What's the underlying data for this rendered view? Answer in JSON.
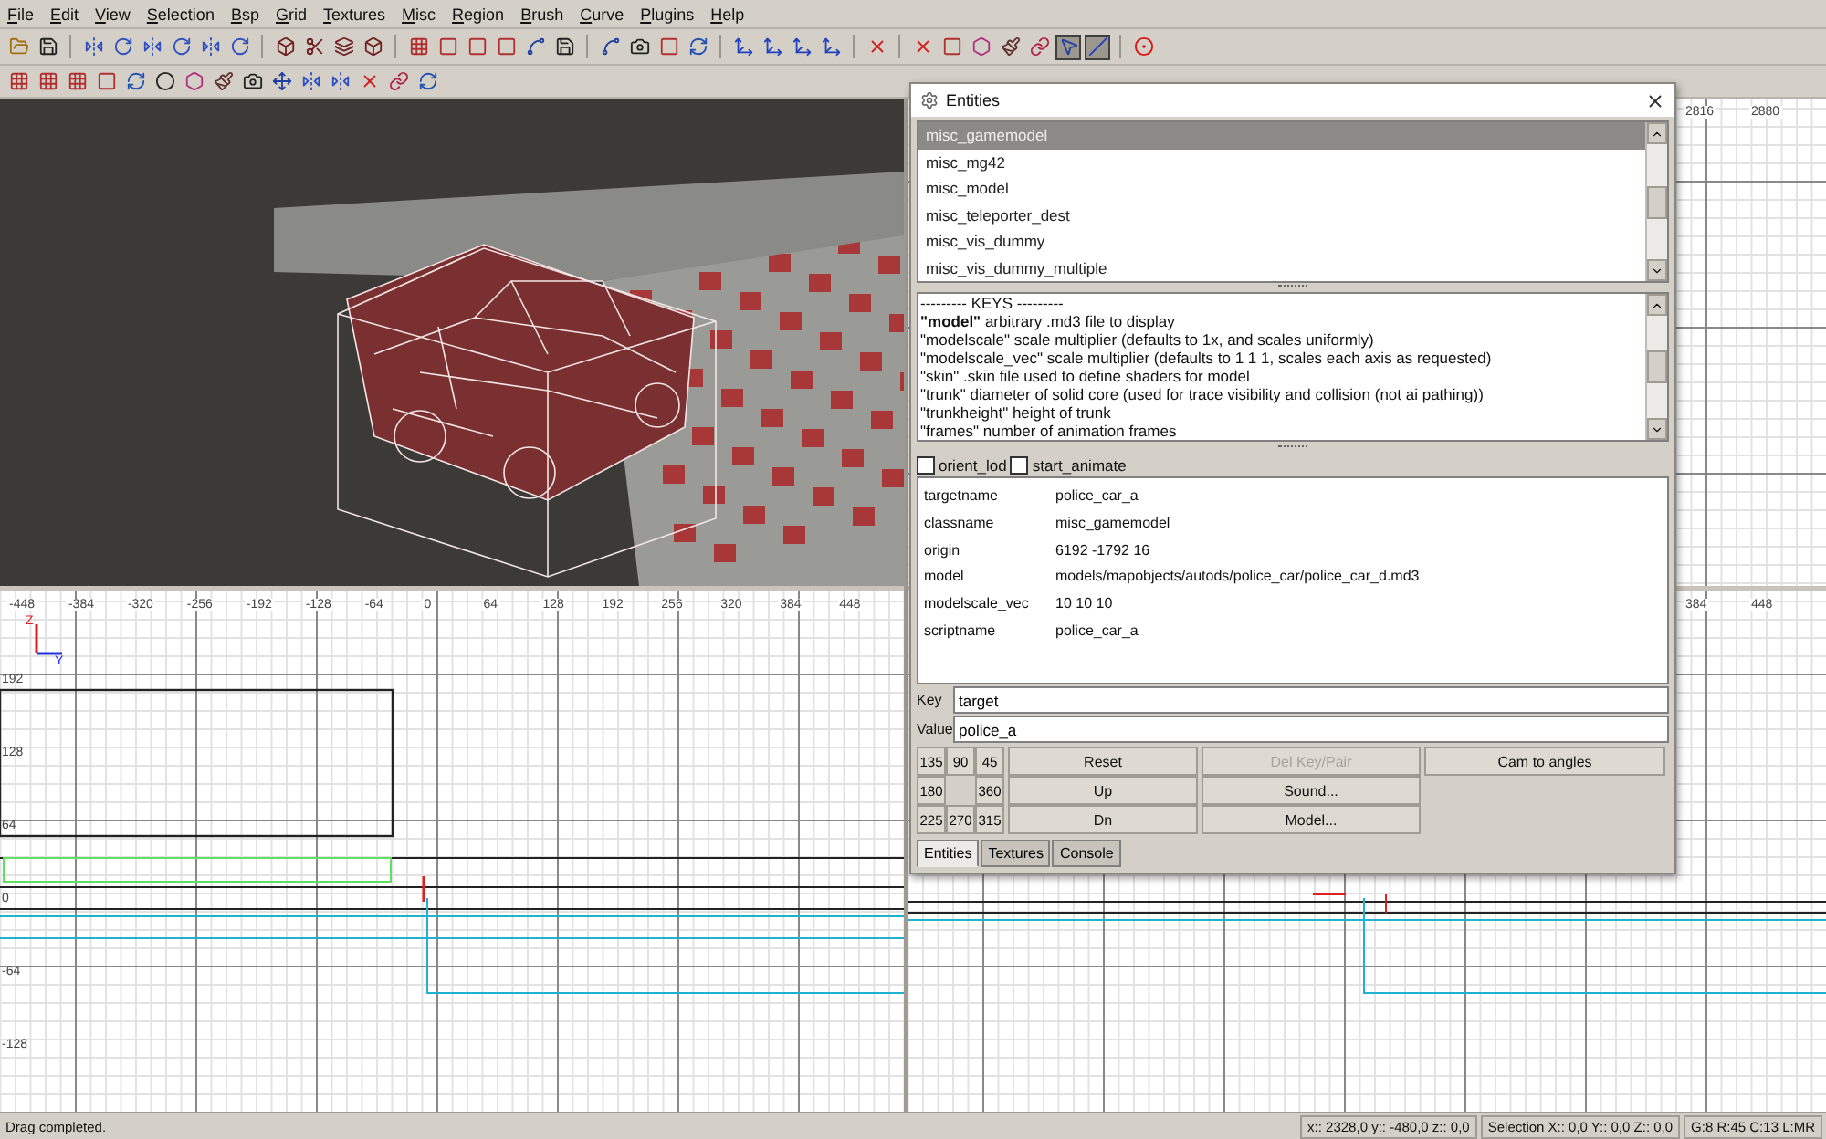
{
  "menu": [
    "File",
    "Edit",
    "View",
    "Selection",
    "Bsp",
    "Grid",
    "Textures",
    "Misc",
    "Region",
    "Brush",
    "Curve",
    "Plugins",
    "Help"
  ],
  "toolbar_1": [
    [
      {
        "kind": "open",
        "pressed": false
      },
      {
        "kind": "save",
        "pressed": false
      }
    ],
    [
      {
        "kind": "flip",
        "pressed": false
      },
      {
        "kind": "rotate",
        "pressed": false
      },
      {
        "kind": "flip",
        "pressed": false
      },
      {
        "kind": "rotate",
        "pressed": false
      },
      {
        "kind": "flip",
        "pressed": false
      },
      {
        "kind": "rotate",
        "pressed": false
      }
    ],
    [
      {
        "kind": "hollow",
        "pressed": false
      },
      {
        "kind": "subtract",
        "pressed": false
      },
      {
        "kind": "merge",
        "pressed": false
      },
      {
        "kind": "hollow",
        "pressed": false
      }
    ],
    [
      {
        "kind": "grid",
        "pressed": false
      },
      {
        "kind": "frame",
        "pressed": false
      },
      {
        "kind": "frame",
        "pressed": false
      },
      {
        "kind": "frame",
        "pressed": false
      },
      {
        "kind": "vertex",
        "pressed": false
      },
      {
        "kind": "save",
        "pressed": false
      }
    ],
    [
      {
        "kind": "vertex",
        "pressed": false
      },
      {
        "kind": "camera",
        "pressed": false
      },
      {
        "kind": "frame",
        "pressed": false
      },
      {
        "kind": "refresh",
        "pressed": false
      }
    ],
    [
      {
        "kind": "axes",
        "pressed": false
      },
      {
        "kind": "axes",
        "pressed": false
      },
      {
        "kind": "axes",
        "pressed": false
      },
      {
        "kind": "axes",
        "pressed": false
      }
    ],
    [
      {
        "kind": "cross",
        "pressed": false
      }
    ],
    [
      {
        "kind": "cross",
        "pressed": false
      },
      {
        "kind": "frame",
        "pressed": false
      },
      {
        "kind": "patch",
        "pressed": false
      },
      {
        "kind": "brush",
        "pressed": false
      },
      {
        "kind": "link",
        "pressed": false
      },
      {
        "kind": "cursor",
        "pressed": true
      },
      {
        "kind": "line",
        "pressed": true
      }
    ],
    [
      {
        "kind": "record",
        "pressed": false
      }
    ]
  ],
  "toolbar_2": [
    [
      {
        "kind": "grid",
        "pressed": false
      },
      {
        "kind": "grid",
        "pressed": false
      },
      {
        "kind": "grid",
        "pressed": false
      },
      {
        "kind": "frame",
        "pressed": false
      },
      {
        "kind": "refresh",
        "pressed": false
      },
      {
        "kind": "ring",
        "pressed": false
      },
      {
        "kind": "patch",
        "pressed": false
      },
      {
        "kind": "brush",
        "pressed": false
      },
      {
        "kind": "camera",
        "pressed": false
      },
      {
        "kind": "move",
        "pressed": false
      },
      {
        "kind": "flip",
        "pressed": false
      },
      {
        "kind": "flip",
        "pressed": false
      },
      {
        "kind": "cross",
        "pressed": false
      },
      {
        "kind": "link",
        "pressed": false
      },
      {
        "kind": "refresh",
        "pressed": false
      }
    ]
  ],
  "views": {
    "side": {
      "x_labels": [
        "-448",
        "-384",
        "-320",
        "-256",
        "-192",
        "-128",
        "-64",
        "0",
        "64",
        "128",
        "192",
        "256",
        "320",
        "384",
        "448"
      ],
      "y_labels": [
        "192",
        "128",
        "64",
        "0",
        "-64",
        "-128"
      ],
      "axis_labels": [
        "Z",
        "Y"
      ]
    },
    "top_right": {
      "x_labels": [
        "2816",
        "2880"
      ]
    },
    "bottom_right": {
      "x_labels": [
        "384",
        "448"
      ]
    }
  },
  "entities": {
    "title": "Entities",
    "classes": [
      {
        "name": "misc_gamemodel",
        "selected": true
      },
      {
        "name": "misc_mg42",
        "selected": false
      },
      {
        "name": "misc_model",
        "selected": false
      },
      {
        "name": "misc_teleporter_dest",
        "selected": false
      },
      {
        "name": "misc_vis_dummy",
        "selected": false
      },
      {
        "name": "misc_vis_dummy_multiple",
        "selected": false
      }
    ],
    "description": [
      "--------- KEYS ---------",
      "**\"model\"**      arbitrary .md3 file to display",
      "\"modelscale\" scale multiplier (defaults to 1x, and scales uniformly)",
      "\"modelscale_vec\" scale multiplier (defaults to 1 1 1, scales each axis as requested)",
      "\"skin\" .skin file used to define shaders for model",
      "\"trunk\" diameter of solid core (used for trace visibility and collision (not ai pathing))",
      "\"trunkheight\" height of trunk",
      "\"frames\" number of animation frames"
    ],
    "flags": [
      {
        "label": "orient_lod",
        "checked": false
      },
      {
        "label": "start_animate",
        "checked": false
      }
    ],
    "properties": [
      {
        "key": "targetname",
        "value": "police_car_a"
      },
      {
        "key": "classname",
        "value": "misc_gamemodel"
      },
      {
        "key": "origin",
        "value": "6192 -1792 16"
      },
      {
        "key": "model",
        "value": "models/mapobjects/autods/police_car/police_car_d.md3"
      },
      {
        "key": "modelscale_vec",
        "value": "10 10 10"
      },
      {
        "key": "scriptname",
        "value": "police_car_a"
      }
    ],
    "key_field": {
      "label": "Key",
      "value": "target"
    },
    "value_field": {
      "label": "Value",
      "value": "police_a"
    },
    "angles": [
      "135",
      "90",
      "45",
      "180",
      "360",
      "225",
      "270",
      "315"
    ],
    "button_columns": [
      [
        {
          "label": "Reset",
          "disabled": false
        },
        {
          "label": "Up",
          "disabled": false
        },
        {
          "label": "Dn",
          "disabled": false
        }
      ],
      [
        {
          "label": "Del Key/Pair",
          "disabled": true
        },
        {
          "label": "Sound...",
          "disabled": false
        },
        {
          "label": "Model...",
          "disabled": false
        }
      ],
      [
        {
          "label": "Cam to angles",
          "disabled": false
        }
      ]
    ],
    "tabs": [
      {
        "label": "Entities",
        "selected": true
      },
      {
        "label": "Textures",
        "selected": false
      },
      {
        "label": "Console",
        "selected": false
      }
    ]
  },
  "status_bar": {
    "message": "Drag completed.",
    "cursor": "x:: 2328,0 y:: -480,0 z:: 0,0",
    "selection": "Selection X:: 0,0 Y:: 0,0 Z:: 0,0",
    "grid": "G:8 R:45 C:13 L:MR"
  }
}
